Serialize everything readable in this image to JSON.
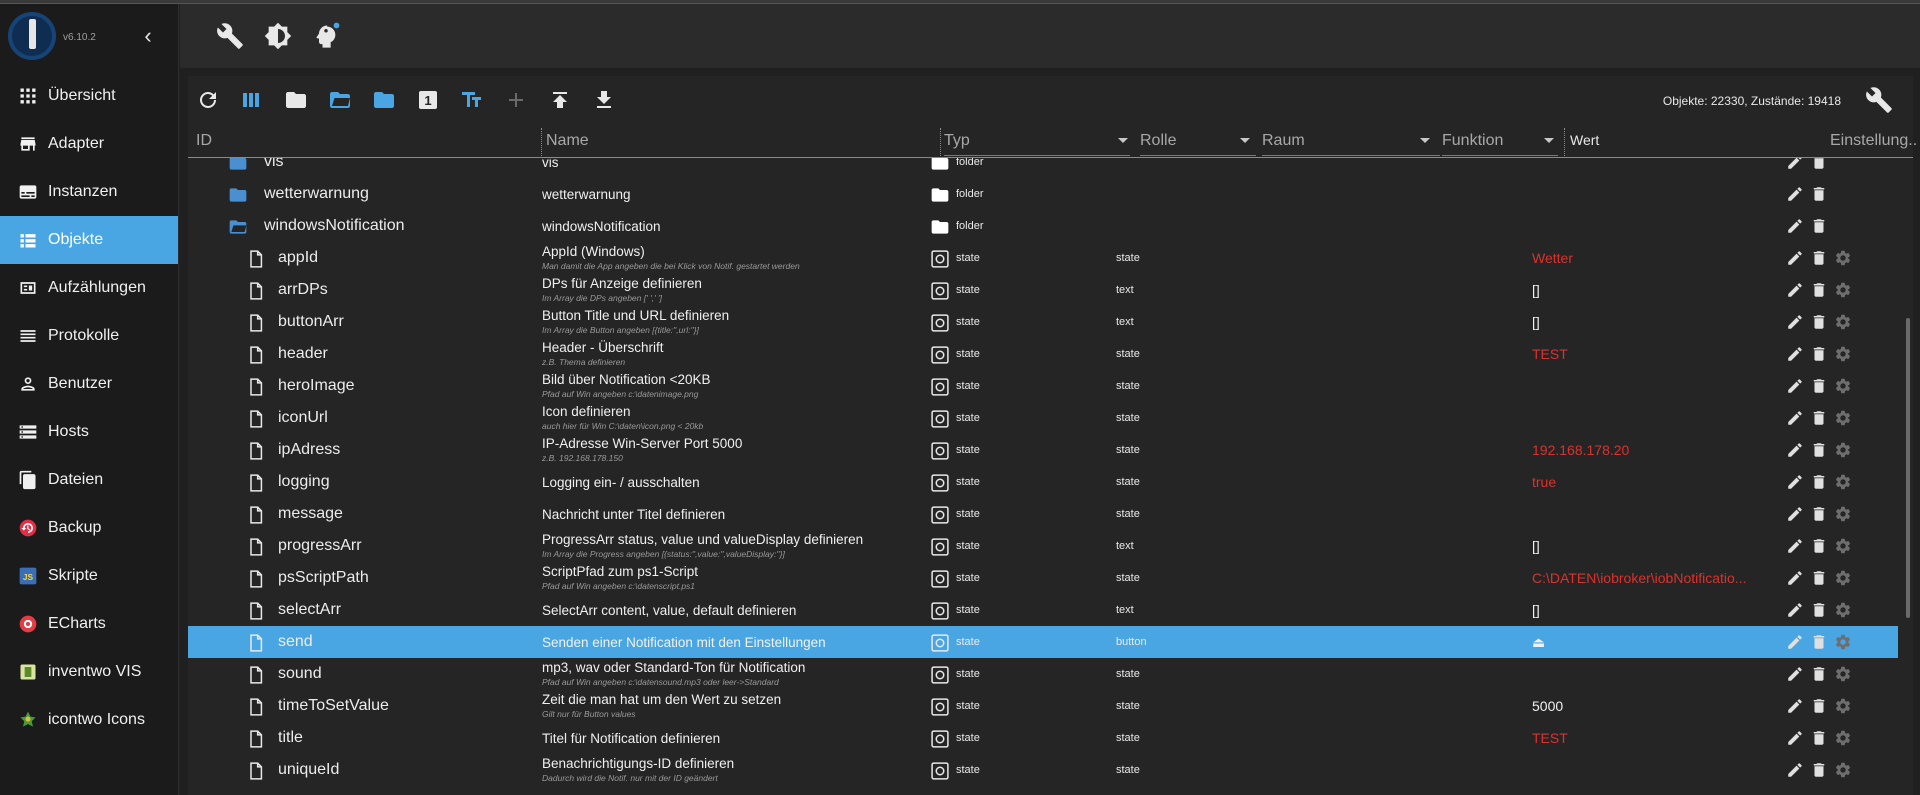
{
  "app": {
    "version": "v6.10.2"
  },
  "sidebar": {
    "items": [
      {
        "label": "Übersicht",
        "icon": "grid-icon"
      },
      {
        "label": "Adapter",
        "icon": "store-icon"
      },
      {
        "label": "Instanzen",
        "icon": "instances-icon"
      },
      {
        "label": "Objekte",
        "icon": "list-icon",
        "active": true
      },
      {
        "label": "Aufzählungen",
        "icon": "enum-icon"
      },
      {
        "label": "Protokolle",
        "icon": "log-icon"
      },
      {
        "label": "Benutzer",
        "icon": "user-icon"
      },
      {
        "label": "Hosts",
        "icon": "hosts-icon"
      },
      {
        "label": "Dateien",
        "icon": "files-icon"
      },
      {
        "label": "Backup",
        "icon": "backup-icon"
      },
      {
        "label": "Skripte",
        "icon": "javascript-icon"
      },
      {
        "label": "ECharts",
        "icon": "echarts-icon"
      },
      {
        "label": "inventwo VIS",
        "icon": "inventwo-icon"
      },
      {
        "label": "icontwo Icons",
        "icon": "icontwo-icon"
      }
    ]
  },
  "toolbar": {
    "counts": "Objekte: 22330, Zustände: 19418"
  },
  "columns": {
    "id": "ID",
    "name": "Name",
    "typ": "Typ",
    "rolle": "Rolle",
    "raum": "Raum",
    "funktion": "Funktion",
    "wert": "Wert",
    "einstellung": "Einstellung..."
  },
  "colors": {
    "accent": "#4aa6e3",
    "value_red": "#e0302b",
    "folder_blue": "#4a90d0"
  },
  "rows": [
    {
      "id": "vis",
      "kind": "folder",
      "name": "vis",
      "desc": "",
      "typ": "folder",
      "rolle": "",
      "wert": "",
      "wert_color": "",
      "settings": false
    },
    {
      "id": "wetterwarnung",
      "kind": "folder",
      "name": "wetterwarnung",
      "desc": "",
      "typ": "folder",
      "rolle": "",
      "wert": "",
      "wert_color": "",
      "settings": false
    },
    {
      "id": "windowsNotification",
      "kind": "folder-open",
      "name": "windowsNotification",
      "desc": "",
      "typ": "folder",
      "rolle": "",
      "wert": "",
      "wert_color": "",
      "settings": false
    },
    {
      "id": "appId",
      "kind": "file",
      "name": "AppId (Windows)",
      "desc": "Man damit die App angeben die bei Klick von Notif. gestartet werden",
      "typ": "state",
      "rolle": "state",
      "wert": "Wetter",
      "wert_color": "red",
      "settings": true
    },
    {
      "id": "arrDPs",
      "kind": "file",
      "name": "DPs für Anzeige definieren",
      "desc": "Im Array die DPs angeben [' ',' ']",
      "typ": "state",
      "rolle": "text",
      "wert": "[]",
      "wert_color": "white",
      "settings": true
    },
    {
      "id": "buttonArr",
      "kind": "file",
      "name": "Button Title und URL definieren",
      "desc": "Im Array die Button angeben [{title:'',url:''}]",
      "typ": "state",
      "rolle": "text",
      "wert": "[]",
      "wert_color": "white",
      "settings": true
    },
    {
      "id": "header",
      "kind": "file",
      "name": "Header - Überschrift",
      "desc": "z.B. Thema definieren",
      "typ": "state",
      "rolle": "state",
      "wert": "TEST",
      "wert_color": "red",
      "settings": true
    },
    {
      "id": "heroImage",
      "kind": "file",
      "name": "Bild über Notification <20KB",
      "desc": "Pfad auf Win angeben c:\\datenimage.png",
      "typ": "state",
      "rolle": "state",
      "wert": "",
      "wert_color": "",
      "settings": true
    },
    {
      "id": "iconUrl",
      "kind": "file",
      "name": "Icon definieren",
      "desc": "auch hier für Win C:\\daten\\icon.png < 20kb",
      "typ": "state",
      "rolle": "state",
      "wert": "",
      "wert_color": "",
      "settings": true
    },
    {
      "id": "ipAdress",
      "kind": "file",
      "name": "IP-Adresse Win-Server Port 5000",
      "desc": "z.B. 192.168.178.150",
      "typ": "state",
      "rolle": "state",
      "wert": "192.168.178.20",
      "wert_color": "red",
      "settings": true
    },
    {
      "id": "logging",
      "kind": "file",
      "name": "Logging ein- / ausschalten",
      "desc": "",
      "typ": "state",
      "rolle": "state",
      "wert": "true",
      "wert_color": "red",
      "settings": true
    },
    {
      "id": "message",
      "kind": "file",
      "name": "Nachricht unter Titel definieren",
      "desc": "",
      "typ": "state",
      "rolle": "state",
      "wert": "",
      "wert_color": "",
      "settings": true
    },
    {
      "id": "progressArr",
      "kind": "file",
      "name": "ProgressArr status, value und valueDisplay definieren",
      "desc": "Im Array die Progress angeben [{status:'',value:'',valueDisplay:''}]",
      "typ": "state",
      "rolle": "text",
      "wert": "[]",
      "wert_color": "white",
      "settings": true
    },
    {
      "id": "psScriptPath",
      "kind": "file",
      "name": "ScriptPfad zum ps1-Script",
      "desc": "Pfad auf Win angeben c:\\datenscript.ps1",
      "typ": "state",
      "rolle": "state",
      "wert": "C:\\DATEN\\iobroker\\iobNotificatio...",
      "wert_color": "red",
      "settings": true
    },
    {
      "id": "selectArr",
      "kind": "file",
      "name": "SelectArr content, value, default definieren",
      "desc": "",
      "typ": "state",
      "rolle": "text",
      "wert": "[]",
      "wert_color": "white",
      "settings": true
    },
    {
      "id": "send",
      "kind": "file",
      "name": "Senden einer Notification mit den Einstellungen",
      "desc": "",
      "typ": "state",
      "rolle": "button",
      "wert": "⏏",
      "wert_color": "white",
      "settings": true,
      "selected": true
    },
    {
      "id": "sound",
      "kind": "file",
      "name": "mp3, wav oder Standard-Ton für Notification",
      "desc": "Pfad auf Win angeben c:\\datensound.mp3 oder leer->Standard",
      "typ": "state",
      "rolle": "state",
      "wert": "",
      "wert_color": "",
      "settings": true
    },
    {
      "id": "timeToSetValue",
      "kind": "file",
      "name": "Zeit die man hat um den Wert zu setzen",
      "desc": "Gilt nur für Button values",
      "typ": "state",
      "rolle": "state",
      "wert": "5000",
      "wert_color": "white",
      "settings": true
    },
    {
      "id": "title",
      "kind": "file",
      "name": "Titel für Notification definieren",
      "desc": "",
      "typ": "state",
      "rolle": "state",
      "wert": "TEST",
      "wert_color": "red",
      "settings": true
    },
    {
      "id": "uniqueId",
      "kind": "file",
      "name": "Benachrichtigungs-ID definieren",
      "desc": "Dadurch wird die Notif. nur mit der ID geändert",
      "typ": "state",
      "rolle": "state",
      "wert": "",
      "wert_color": "",
      "settings": true
    }
  ]
}
